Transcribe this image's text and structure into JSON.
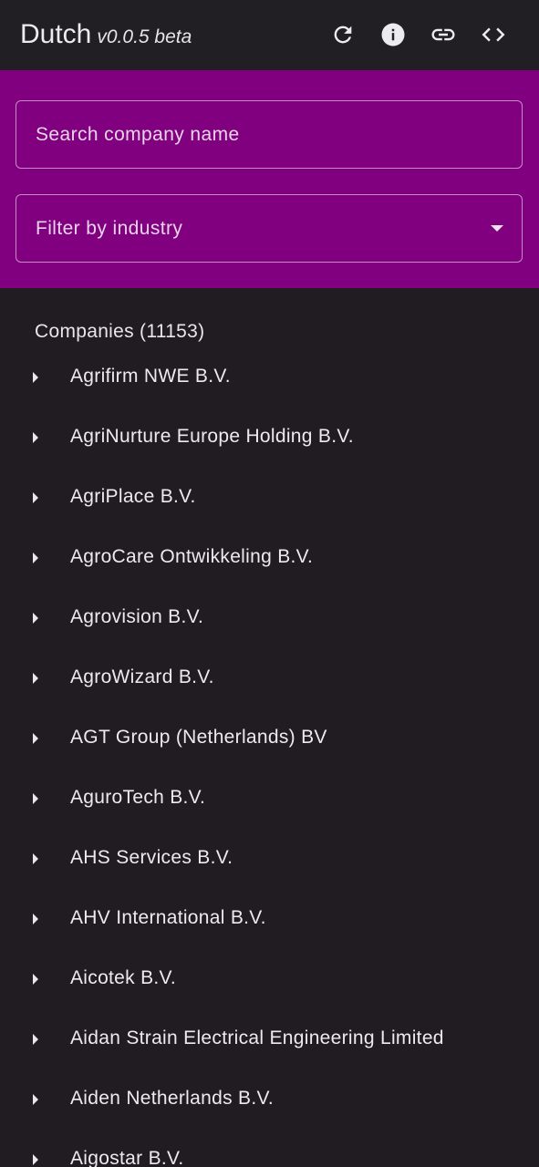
{
  "app": {
    "title": "Dutch",
    "version": "v0.0.5 beta"
  },
  "toolbar": {
    "icons": [
      "refresh-icon",
      "info-icon",
      "link-icon",
      "code-icon"
    ]
  },
  "search": {
    "placeholder": "Search company name",
    "value": ""
  },
  "industry_filter": {
    "label": "Filter by industry",
    "icon": "dropdown-arrow-icon"
  },
  "companies": {
    "header": "Companies (11153)",
    "items": [
      "Agrifirm NWE B.V.",
      "AgriNurture Europe Holding B.V.",
      "AgriPlace B.V.",
      "AgroCare Ontwikkeling B.V.",
      "Agrovision B.V.",
      "AgroWizard B.V.",
      "AGT Group (Netherlands) BV",
      "AguroTech B.V.",
      "AHS Services B.V.",
      "AHV International B.V.",
      "Aicotek B.V.",
      "Aidan Strain Electrical Engineering Limited",
      "Aiden Netherlands B.V.",
      "Aigostar B.V."
    ]
  },
  "colors": {
    "accent": "#800080",
    "background": "#201c22",
    "topbar": "#211f24",
    "text": "#eceaf0"
  }
}
